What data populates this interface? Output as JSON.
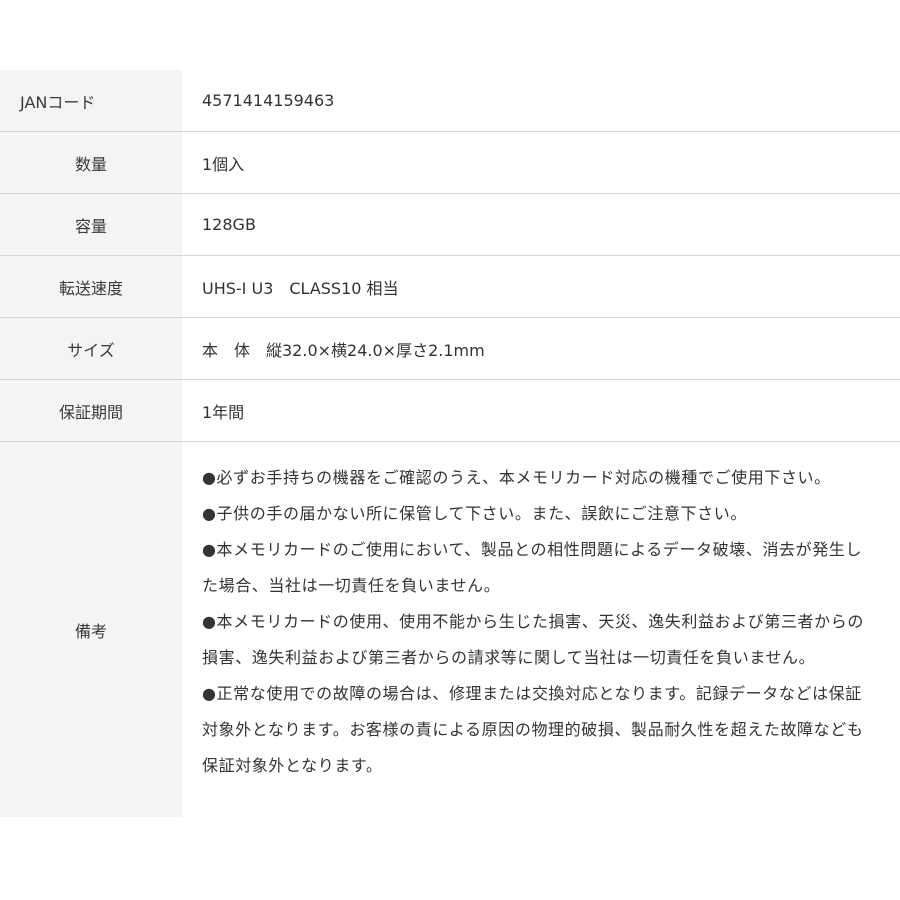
{
  "spec_table": {
    "rows": [
      {
        "label": "JANコード",
        "value": "4571414159463"
      },
      {
        "label": "数量",
        "value": "1個入"
      },
      {
        "label": "容量",
        "value": "128GB"
      },
      {
        "label": "転送速度",
        "value": "UHS-I U3　CLASS10 相当"
      },
      {
        "label": "サイズ",
        "value": "本　体　縦32.0×横24.0×厚さ2.1mm"
      },
      {
        "label": "保証期間",
        "value": "1年間"
      }
    ],
    "notes": {
      "label": "備考",
      "items": [
        "●必ずお手持ちの機器をご確認のうえ、本メモリカード対応の機種でご使用下さい。",
        "●子供の手の届かない所に保管して下さい。また、誤飲にご注意下さい。",
        "●本メモリカードのご使用において、製品との相性問題によるデータ破壊、消去が発生した場合、当社は一切責任を負いません。",
        "●本メモリカードの使用、使用不能から生じた損害、天災、逸失利益および第三者からの損害、逸失利益および第三者からの請求等に関して当社は一切責任を負いません。",
        "●正常な使用での故障の場合は、修理または交換対応となります。記録データなどは保証対象外となります。お客様の責による原因の物理的破損、製品耐久性を超えた故障なども保証対象外となります。"
      ]
    }
  }
}
